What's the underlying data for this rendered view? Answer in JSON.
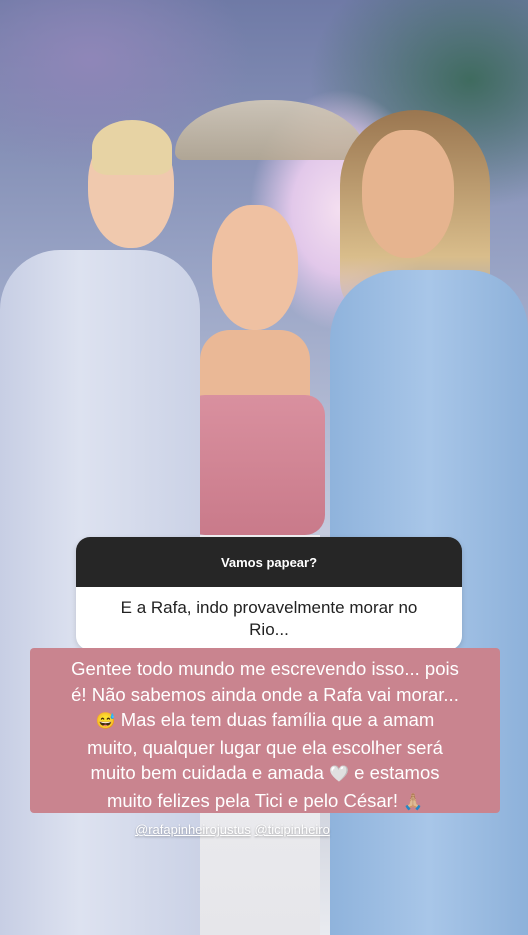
{
  "story": {
    "question_sticker": {
      "title": "Vamos papear?",
      "question": "E a Rafa, indo provavelmente morar no Rio..."
    },
    "answer": {
      "lines": [
        "Gentee todo mundo me escrevendo isso... pois",
        "é! Não sabemos ainda onde a Rafa vai morar...",
        "Mas ela tem duas família que a amam",
        "muito,  qualquer lugar que ela escolher será",
        "muito bem cuidada e amada",
        "e estamos",
        "muito felizes pela Tici e pelo César!"
      ],
      "emoji_sweat_smile": "😅",
      "emoji_white_heart": "🤍",
      "emoji_pray": "🙏🏼"
    },
    "mentions": [
      "@rafapinheirojustus",
      "@ticipinheiro"
    ]
  }
}
